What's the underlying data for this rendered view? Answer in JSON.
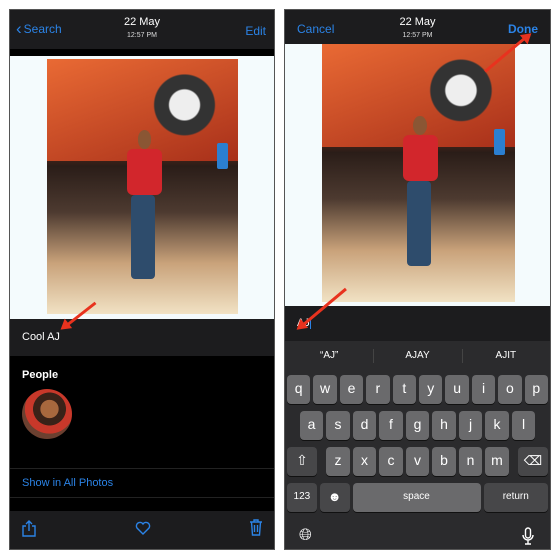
{
  "left": {
    "nav": {
      "back_label": "Search",
      "date": "22 May",
      "time": "12:57 PM",
      "edit_label": "Edit"
    },
    "caption": "Cool AJ",
    "people_heading": "People",
    "show_all_label": "Show in All Photos",
    "toolbar": {
      "share": "share-icon",
      "favorite": "heart-icon",
      "delete": "trash-icon"
    }
  },
  "right": {
    "nav": {
      "cancel_label": "Cancel",
      "date": "22 May",
      "time": "12:57 PM",
      "done_label": "Done"
    },
    "caption_input": "AJ",
    "suggestions": [
      "“AJ”",
      "AJAY",
      "AJIT"
    ],
    "keyboard": {
      "row1": [
        "q",
        "w",
        "e",
        "r",
        "t",
        "y",
        "u",
        "i",
        "o",
        "p"
      ],
      "row2": [
        "a",
        "s",
        "d",
        "f",
        "g",
        "h",
        "j",
        "k",
        "l"
      ],
      "row3": [
        "z",
        "x",
        "c",
        "v",
        "b",
        "n",
        "m"
      ],
      "numbers_label": "123",
      "space_label": "space",
      "return_label": "return"
    }
  },
  "colors": {
    "accent": "#2b83e6",
    "arrow": "#e8321e",
    "bar": "#1c1c1e"
  }
}
